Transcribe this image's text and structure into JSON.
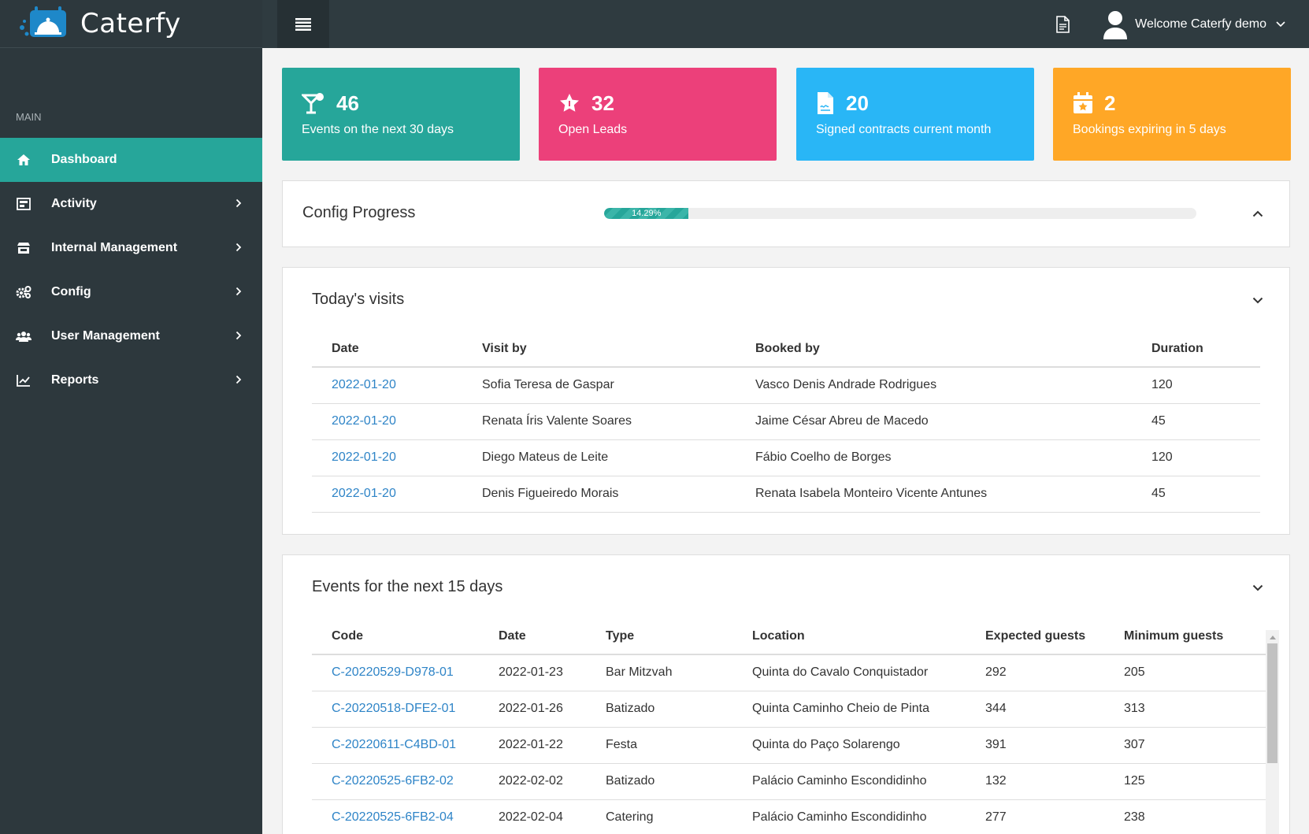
{
  "brand": {
    "name": "Caterfy"
  },
  "header": {
    "welcome": "Welcome Caterfy demo"
  },
  "sidebar": {
    "section": "MAIN",
    "items": [
      {
        "label": "Dashboard",
        "icon": "home-icon"
      },
      {
        "label": "Activity",
        "icon": "activity-icon"
      },
      {
        "label": "Internal Management",
        "icon": "store-icon"
      },
      {
        "label": "Config",
        "icon": "gears-icon"
      },
      {
        "label": "User Management",
        "icon": "users-icon"
      },
      {
        "label": "Reports",
        "icon": "chart-icon"
      }
    ]
  },
  "stats": [
    {
      "value": "46",
      "label": "Events on the next 30 days",
      "color": "#26a69a",
      "icon": "cocktail-icon"
    },
    {
      "value": "32",
      "label": "Open Leads",
      "color": "#ec407a",
      "icon": "star-icon"
    },
    {
      "value": "20",
      "label": "Signed contracts current month",
      "color": "#29b6f6",
      "icon": "contract-icon"
    },
    {
      "value": "2",
      "label": "Bookings expiring in 5 days",
      "color": "#ffa726",
      "icon": "calendar-star-icon"
    }
  ],
  "config_progress": {
    "title": "Config Progress",
    "percent_label": "14.29%",
    "percent": 14.29
  },
  "visits": {
    "title": "Today's visits",
    "columns": [
      "Date",
      "Visit by",
      "Booked by",
      "Duration"
    ],
    "rows": [
      [
        "2022-01-20",
        "Sofia Teresa de Gaspar",
        "Vasco Denis Andrade Rodrigues",
        "120"
      ],
      [
        "2022-01-20",
        "Renata Íris Valente Soares",
        "Jaime César Abreu de Macedo",
        "45"
      ],
      [
        "2022-01-20",
        "Diego Mateus de Leite",
        "Fábio Coelho de Borges",
        "120"
      ],
      [
        "2022-01-20",
        "Denis Figueiredo Morais",
        "Renata Isabela Monteiro Vicente Antunes",
        "45"
      ]
    ]
  },
  "events": {
    "title": "Events for the next 15 days",
    "columns": [
      "Code",
      "Date",
      "Type",
      "Location",
      "Expected guests",
      "Minimum guests"
    ],
    "rows": [
      [
        "C-20220529-D978-01",
        "2022-01-23",
        "Bar Mitzvah",
        "Quinta do Cavalo Conquistador",
        "292",
        "205"
      ],
      [
        "C-20220518-DFE2-01",
        "2022-01-26",
        "Batizado",
        "Quinta Caminho Cheio de Pinta",
        "344",
        "313"
      ],
      [
        "C-20220611-C4BD-01",
        "2022-01-22",
        "Festa",
        "Quinta do Paço Solarengo",
        "391",
        "307"
      ],
      [
        "C-20220525-6FB2-02",
        "2022-02-02",
        "Batizado",
        "Palácio Caminho Escondidinho",
        "132",
        "125"
      ],
      [
        "C-20220525-6FB2-04",
        "2022-02-04",
        "Catering",
        "Palácio Caminho Escondidinho",
        "277",
        "238"
      ]
    ]
  }
}
